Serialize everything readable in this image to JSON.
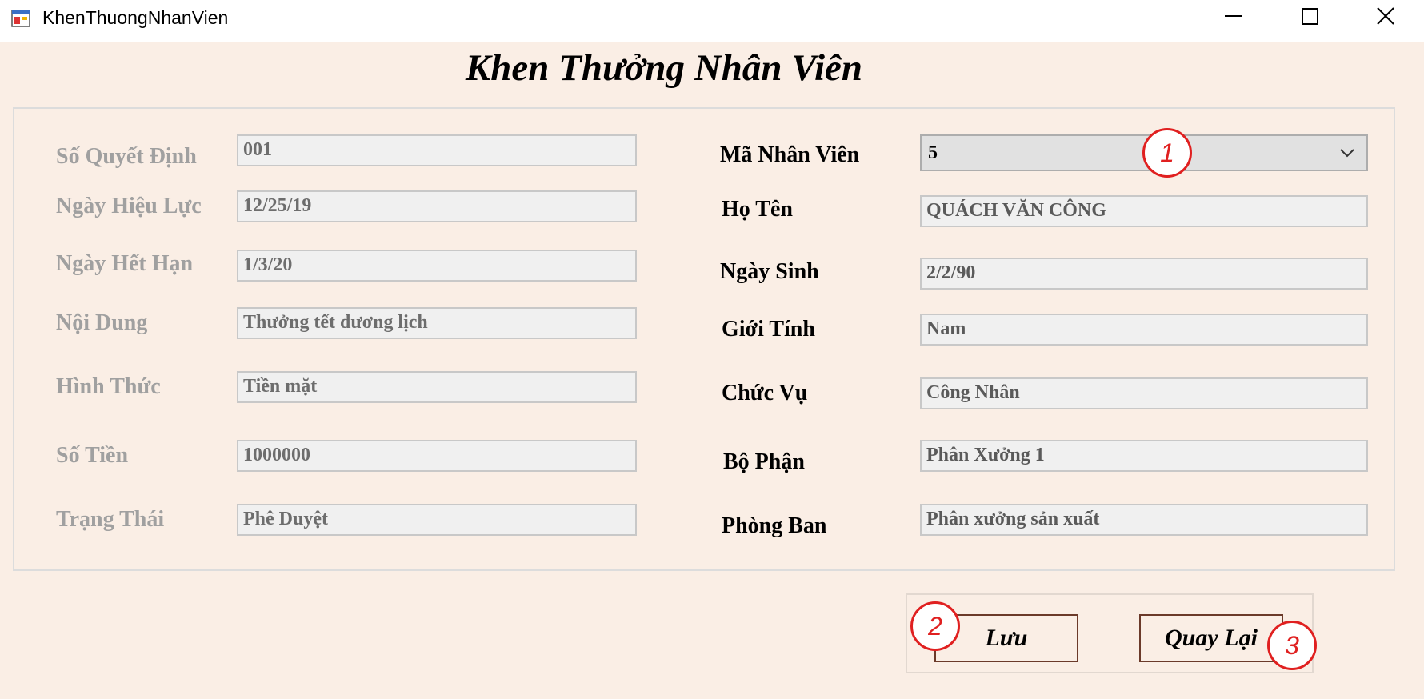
{
  "window": {
    "title": "KhenThuongNhanVien"
  },
  "form": {
    "heading": "Khen Thưởng Nhân Viên"
  },
  "left_fields": [
    {
      "label": "Số Quyết Định",
      "value": "001"
    },
    {
      "label": "Ngày Hiệu Lực",
      "value": "12/25/19"
    },
    {
      "label": "Ngày Hết Hạn",
      "value": "1/3/20"
    },
    {
      "label": "Nội Dung",
      "value": "Thưởng tết dương lịch"
    },
    {
      "label": "Hình Thức",
      "value": "Tiền mặt"
    },
    {
      "label": "Số Tiền",
      "value": "1000000"
    },
    {
      "label": "Trạng Thái",
      "value": "Phê Duyệt"
    }
  ],
  "employee": {
    "id_label": "Mã Nhân Viên",
    "id_selected": "5",
    "fields": [
      {
        "label": "Họ Tên",
        "value": "QUÁCH VĂN CÔNG"
      },
      {
        "label": "Ngày Sinh",
        "value": "2/2/90"
      },
      {
        "label": "Giới Tính",
        "value": "Nam"
      },
      {
        "label": "Chức Vụ",
        "value": "Công Nhân"
      },
      {
        "label": "Bộ Phận",
        "value": "Phân Xưởng 1"
      },
      {
        "label": "Phòng Ban",
        "value": "Phân xưởng sản xuất"
      }
    ]
  },
  "buttons": {
    "save_label": "Lưu",
    "back_label": "Quay Lại"
  },
  "annotations": {
    "badge_1": "1",
    "badge_2": "2",
    "badge_3": "3",
    "color": "#e02020"
  }
}
